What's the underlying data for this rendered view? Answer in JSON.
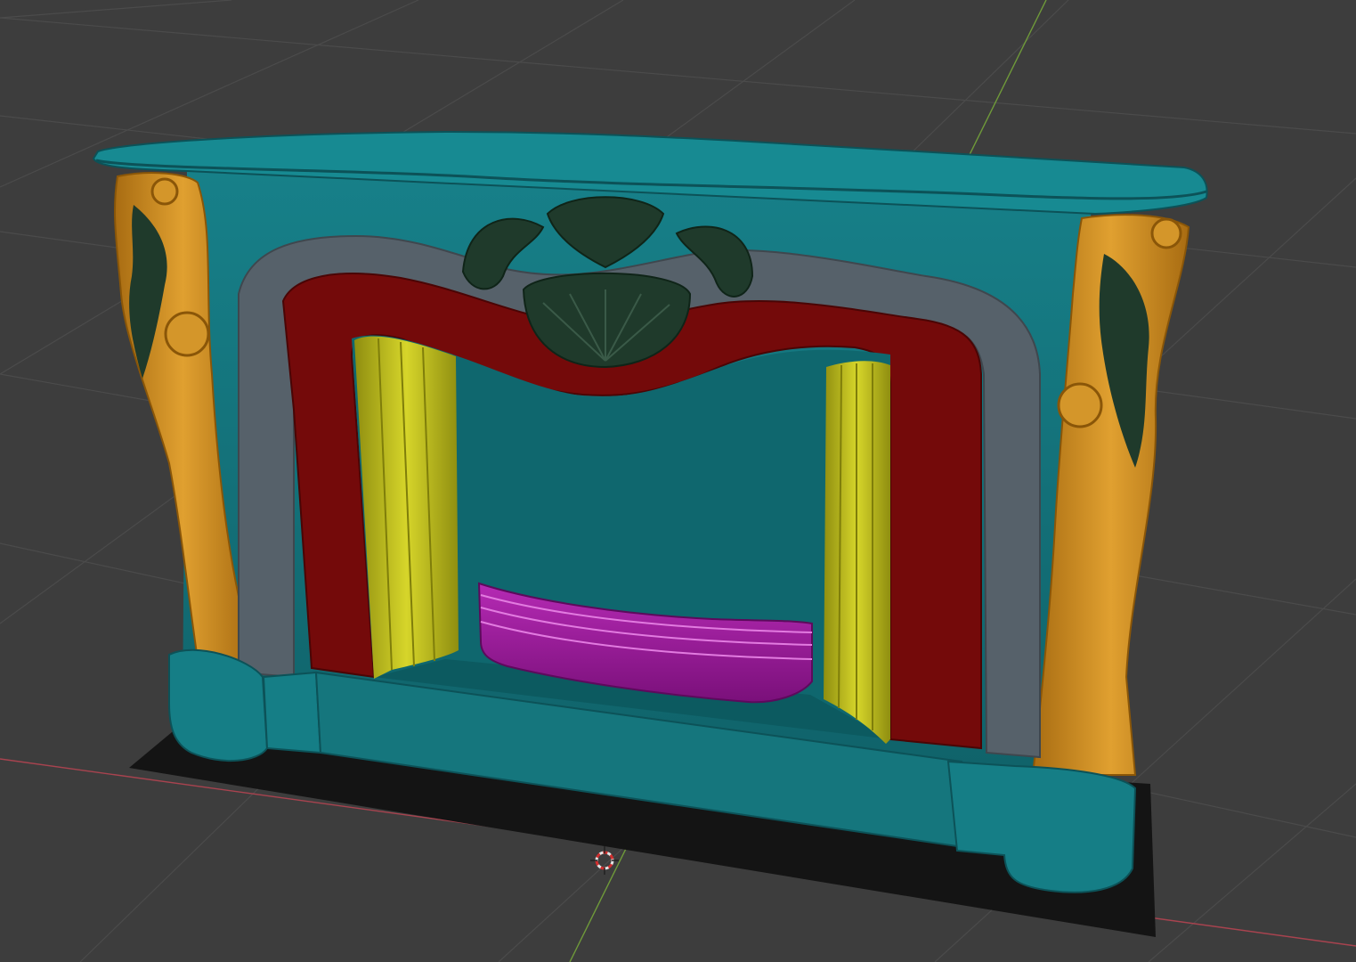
{
  "viewport": {
    "view": "3d-viewport",
    "background": "#3d3d3d",
    "grid_color": "#4a4a4a",
    "x_axis_color": "#a8434f",
    "y_axis_color": "#6f9a3a"
  },
  "scene": {
    "object": "fireplace-model",
    "materials": {
      "teal": "#15737a",
      "teal_dark": "#0f5a60",
      "orange": "#c9871c",
      "red": "#7a0a0a",
      "grey": "#55616a",
      "yellow": "#b9b81a",
      "magenta": "#9a1a99",
      "dark_green": "#1f3a2b",
      "base_plate": "#111111"
    }
  },
  "cursor_3d": {
    "icon": "3d-cursor-icon"
  }
}
